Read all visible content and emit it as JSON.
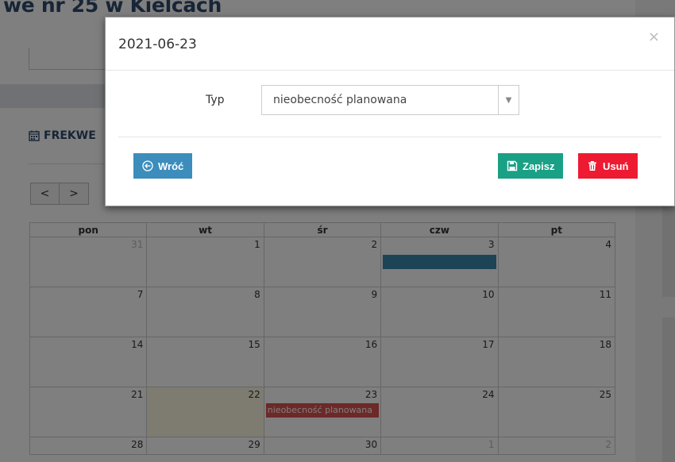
{
  "background": {
    "page_title": "we nr 25 w Kielcach",
    "section_title": "FREKWE",
    "nav_prev": "<",
    "nav_next": ">",
    "calendar": {
      "headers": [
        "pon",
        "wt",
        "śr",
        "czw",
        "pt"
      ],
      "rows": [
        [
          "31",
          "1",
          "2",
          "3",
          "4"
        ],
        [
          "7",
          "8",
          "9",
          "10",
          "11"
        ],
        [
          "14",
          "15",
          "16",
          "17",
          "18"
        ],
        [
          "21",
          "22",
          "23",
          "24",
          "25"
        ],
        [
          "28",
          "29",
          "30",
          "1",
          "2"
        ]
      ],
      "event_label": "nieobecność planowana"
    }
  },
  "modal": {
    "title": "2021-06-23",
    "close": "×",
    "field_label": "Typ",
    "select_value": "nieobecność planowana",
    "select_arrow": "▼",
    "back_label": "Wróć",
    "save_label": "Zapisz",
    "delete_label": "Usuń"
  },
  "colors": {
    "back": "#3c8dbc",
    "save": "#1aa085",
    "delete": "#ee1a32",
    "event_blue": "#3a87ad",
    "event_red": "#d9534f"
  }
}
